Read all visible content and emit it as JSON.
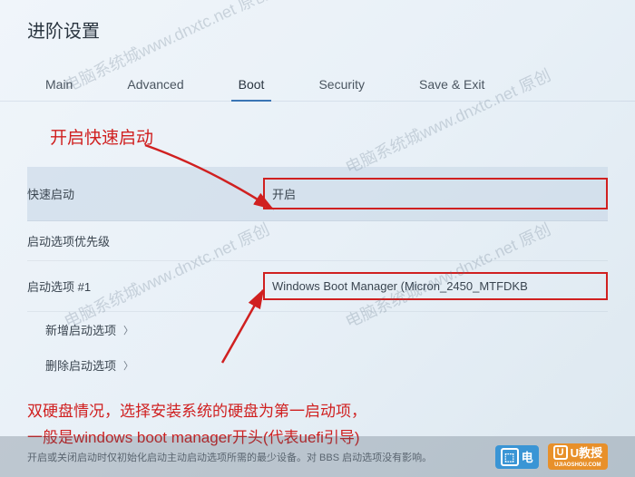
{
  "header": {
    "title": "进阶设置"
  },
  "tabs": [
    {
      "label": "Main",
      "active": false
    },
    {
      "label": "Advanced",
      "active": false
    },
    {
      "label": "Boot",
      "active": true
    },
    {
      "label": "Security",
      "active": false
    },
    {
      "label": "Save & Exit",
      "active": false
    }
  ],
  "annotations": {
    "top": "开启快速启动",
    "bottom_line1": "双硬盘情况，选择安装系统的硬盘为第一启动项，",
    "bottom_line2": "一般是windows boot manager开头(代表uefi引导)"
  },
  "rows": {
    "fast_boot": {
      "label": "快速启动",
      "value": "开启"
    },
    "boot_priority": {
      "label": "启动选项优先级"
    },
    "boot_option_1": {
      "label": "启动选项 #1",
      "value": "Windows Boot Manager (Micron_2450_MTFDKB"
    },
    "add_boot": {
      "label": "新增启动选项"
    },
    "delete_boot": {
      "label": "删除启动选项"
    }
  },
  "footer": {
    "text": "开启或关闭启动时仅初始化启动主动启动选项所需的最少设备。对 BBS 启动选项没有影响。"
  },
  "watermarks": [
    "电脑系统城www.dnxtc.net 原创",
    "电脑系统城www.dnxtc.net 原创",
    "电脑系统城www.dnxtc.net 原创",
    "电脑系统城www.dnxtc.net 原创"
  ],
  "badges": {
    "blue_text": "电",
    "orange_text": "U教授",
    "orange_sub": "UJIAOSHOU.COM"
  }
}
